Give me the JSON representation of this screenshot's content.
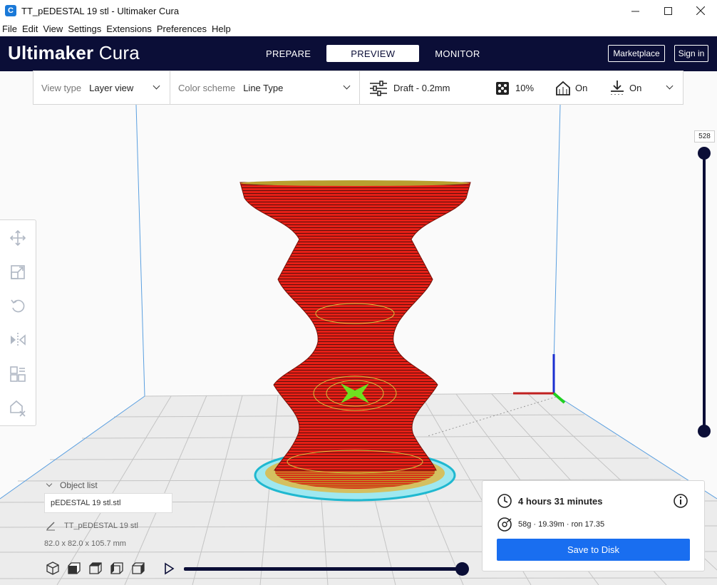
{
  "window": {
    "app_icon": "C",
    "title": "TT_pEDESTAL 19 stl - Ultimaker Cura",
    "controls": [
      "minimize-icon",
      "maximize-icon",
      "close-icon"
    ]
  },
  "menu": [
    "File",
    "Edit",
    "View",
    "Settings",
    "Extensions",
    "Preferences",
    "Help"
  ],
  "header": {
    "brand_bold": "Ultimaker",
    "brand_light": "Cura",
    "tabs": [
      {
        "label": "PREPARE",
        "active": false
      },
      {
        "label": "PREVIEW",
        "active": true
      },
      {
        "label": "MONITOR",
        "active": false
      }
    ],
    "marketplace_label": "Marketplace",
    "signin_label": "Sign in"
  },
  "toolbar": {
    "view_type_label": "View type",
    "view_type_value": "Layer view",
    "color_scheme_label": "Color scheme",
    "color_scheme_value": "Line Type",
    "profile": "Draft - 0.2mm",
    "infill": "10%",
    "support": "On",
    "adhesion": "On"
  },
  "left_tools": [
    "move-icon",
    "scale-icon",
    "rotate-icon",
    "mirror-icon",
    "per-model-settings-icon",
    "support-blocker-icon"
  ],
  "layer_slider": {
    "current_layer": "528"
  },
  "object_list": {
    "toggle_label": "Object list",
    "file_name": "pEDESTAL 19 stl.stl",
    "object_name": "TT_pEDESTAL 19 stl",
    "dimensions": "82.0 x 82.0 x 105.7 mm"
  },
  "view_buttons": [
    "3d-view-icon",
    "front-view-icon",
    "top-view-icon",
    "left-view-icon",
    "right-view-icon"
  ],
  "playback": {
    "progress_fraction": 1.0
  },
  "print_info": {
    "time": "4 hours 31 minutes",
    "material": "58g · 19.39m · ron 17.35",
    "save_label": "Save to Disk"
  },
  "colors": {
    "header_bg": "#0b0e37",
    "accent_blue": "#196ef0",
    "model_red": "#e8231b",
    "skin_yellow": "#c8b030",
    "skirt_cyan": "#3fd0e0"
  }
}
